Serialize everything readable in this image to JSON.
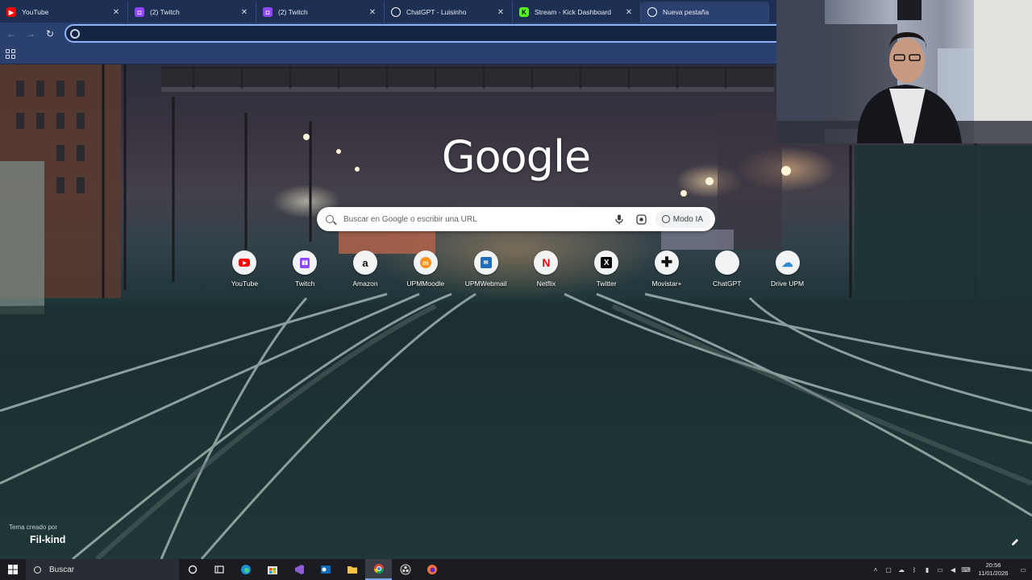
{
  "browser": {
    "tabs": [
      {
        "title": "YouTube",
        "favicon": "youtube-icon",
        "color": "#ff0000",
        "active": false
      },
      {
        "title": "(2) Twitch",
        "favicon": "twitch-icon",
        "color": "#9146ff",
        "active": false
      },
      {
        "title": "(2) Twitch",
        "favicon": "twitch-icon",
        "color": "#9146ff",
        "active": false
      },
      {
        "title": "ChatGPT - Luisinho",
        "favicon": "chatgpt-icon",
        "color": "#ffffff",
        "active": false
      },
      {
        "title": "Stream - Kick Dashboard",
        "favicon": "kick-icon",
        "color": "#53fc18",
        "active": false
      },
      {
        "title": "Nueva pestaña",
        "favicon": "chrome-icon",
        "color": "#ffffff",
        "active": true
      }
    ],
    "omnibox": {
      "value": "",
      "placeholder": ""
    }
  },
  "newtab": {
    "logo": "Google",
    "search_placeholder": "Buscar en Google o escribir una URL",
    "ai_mode_label": "Modo IA",
    "shortcuts": [
      {
        "label": "YouTube",
        "icon": "youtube-icon"
      },
      {
        "label": "Twitch",
        "icon": "twitch-icon"
      },
      {
        "label": "Amazon",
        "icon": "amazon-icon"
      },
      {
        "label": "UPMMoodle",
        "icon": "moodle-icon"
      },
      {
        "label": "UPMWebmail",
        "icon": "webmail-icon"
      },
      {
        "label": "Netflix",
        "icon": "netflix-icon"
      },
      {
        "label": "Twitter",
        "icon": "x-icon"
      },
      {
        "label": "Movistar+",
        "icon": "plus-icon"
      },
      {
        "label": "ChatGPT",
        "icon": "chatgpt-icon"
      },
      {
        "label": "Drive UPM",
        "icon": "cloud-icon"
      }
    ],
    "attribution_small": "Tema creado por",
    "attribution_author": "Fil-kind"
  },
  "taskbar": {
    "search_label": "Buscar",
    "time": "20:56",
    "date": "11/01/2026"
  },
  "colors": {
    "tab_strip": "#1d2f52",
    "toolbar": "#2a4170",
    "omnibox_focus": "#8fb4f4",
    "taskbar": "#1a1c22"
  }
}
